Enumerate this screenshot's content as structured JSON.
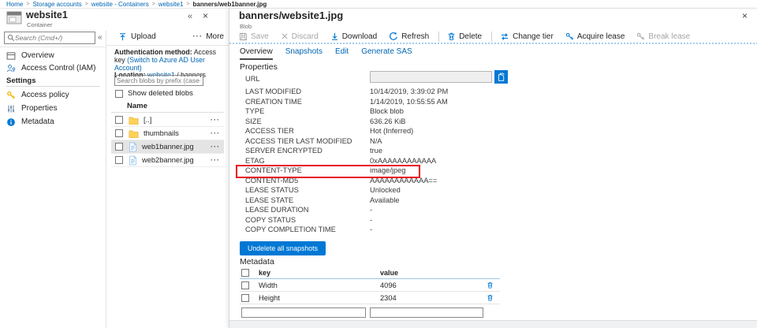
{
  "colors": {
    "accent_blue": "#0078d4",
    "link_blue": "#0065b3",
    "highlight_red": "#e81123",
    "folder_yellow": "#ffd158",
    "disabled_grey": "#a6a6a6",
    "selected_row_grey": "#e4e4e4"
  },
  "icons": {
    "container-icon": "grey container/window box",
    "search-icon": "magnifier",
    "overview-icon": "window outline",
    "access-control-icon": "person",
    "key-icon": "yellow key",
    "properties-icon": "slider bars",
    "info-icon": "blue info circle",
    "upload-icon": "arrow up with bar",
    "more-icon": "ellipsis dots",
    "folder-icon": "yellow folder",
    "file-icon": "blue document page",
    "row-menu-icon": "ellipsis dots",
    "save-icon": "floppy disk",
    "discard-icon": "x cross",
    "download-icon": "arrow down with bar",
    "refresh-icon": "circular arrow",
    "delete-icon": "trash can",
    "change-tier-icon": "swap arrows",
    "lease-key-icon": "key",
    "copy-icon": "two pages",
    "trash-icon": "trash can",
    "close-icon": "x cross",
    "collapse-icon": "double chevron left"
  },
  "breadcrumb": {
    "separator": ">",
    "items": [
      {
        "label": "Home"
      },
      {
        "label": "Storage accounts"
      },
      {
        "label": "website - Containers"
      },
      {
        "label": "website1"
      },
      {
        "label": "banners/web1banner.jpg"
      }
    ]
  },
  "container_blade": {
    "title": "website1",
    "subtitle": "Container",
    "collapse_glyph": "«",
    "close_glyph": "×",
    "search_placeholder": "Search (Cmd+/)",
    "nav": {
      "overview": "Overview",
      "access_control": "Access Control (IAM)",
      "settings_header": "Settings",
      "access_policy": "Access policy",
      "properties": "Properties",
      "metadata": "Metadata"
    },
    "explorer": {
      "upload": "Upload",
      "more": "More",
      "more_dots": "···",
      "auth_label": "Authentication method:",
      "auth_value": "Access key",
      "auth_link": "(Switch to Azure AD User Account)",
      "location_label": "Location:",
      "location_link": "website1",
      "location_suffix": "/ banners",
      "search_placeholder": "Search blobs by prefix (case-se...",
      "show_deleted": "Show deleted blobs",
      "name_header": "Name",
      "menu_dots": "···",
      "rows": [
        {
          "name": "[..]",
          "type": "folder",
          "selected": false
        },
        {
          "name": "thumbnails",
          "type": "folder",
          "selected": false
        },
        {
          "name": "web1banner.jpg",
          "type": "file",
          "selected": true
        },
        {
          "name": "web2banner.jpg",
          "type": "file",
          "selected": false
        }
      ]
    }
  },
  "blob_blade": {
    "title": "banners/website1.jpg",
    "subtitle": "Blob",
    "close_glyph": "×",
    "toolbar": {
      "save": "Save",
      "discard": "Discard",
      "download": "Download",
      "refresh": "Refresh",
      "delete": "Delete",
      "change_tier": "Change tier",
      "acquire_lease": "Acquire lease",
      "break_lease": "Break lease"
    },
    "tabs": {
      "overview": "Overview",
      "snapshots": "Snapshots",
      "edit": "Edit",
      "generate_sas": "Generate SAS"
    },
    "properties_heading": "Properties",
    "url_label": "URL",
    "properties": [
      {
        "label": "LAST MODIFIED",
        "value": "10/14/2019, 3:39:02 PM"
      },
      {
        "label": "CREATION TIME",
        "value": "1/14/2019, 10:55:55 AM"
      },
      {
        "label": "TYPE",
        "value": "Block blob"
      },
      {
        "label": "SIZE",
        "value": "636.26 KiB"
      },
      {
        "label": "ACCESS TIER",
        "value": "Hot (Inferred)"
      },
      {
        "label": "ACCESS TIER LAST MODIFIED",
        "value": "N/A"
      },
      {
        "label": "SERVER ENCRYPTED",
        "value": "true"
      },
      {
        "label": "ETAG",
        "value": "0xAAAAAAAAAAAA"
      },
      {
        "label": "CONTENT-TYPE",
        "value": "image/jpeg",
        "highlighted": true
      },
      {
        "label": "CONTENT-MD5",
        "value": "AAAAAAAAAAAA=="
      },
      {
        "label": "LEASE STATUS",
        "value": "Unlocked"
      },
      {
        "label": "LEASE STATE",
        "value": "Available"
      },
      {
        "label": "LEASE DURATION",
        "value": "-"
      },
      {
        "label": "COPY STATUS",
        "value": "-"
      },
      {
        "label": "COPY COMPLETION TIME",
        "value": "-"
      }
    ],
    "undelete_button": "Undelete all snapshots",
    "metadata": {
      "heading": "Metadata",
      "key_header": "key",
      "value_header": "value",
      "rows": [
        {
          "key": "Width",
          "value": "4096"
        },
        {
          "key": "Height",
          "value": "2304"
        }
      ]
    }
  }
}
